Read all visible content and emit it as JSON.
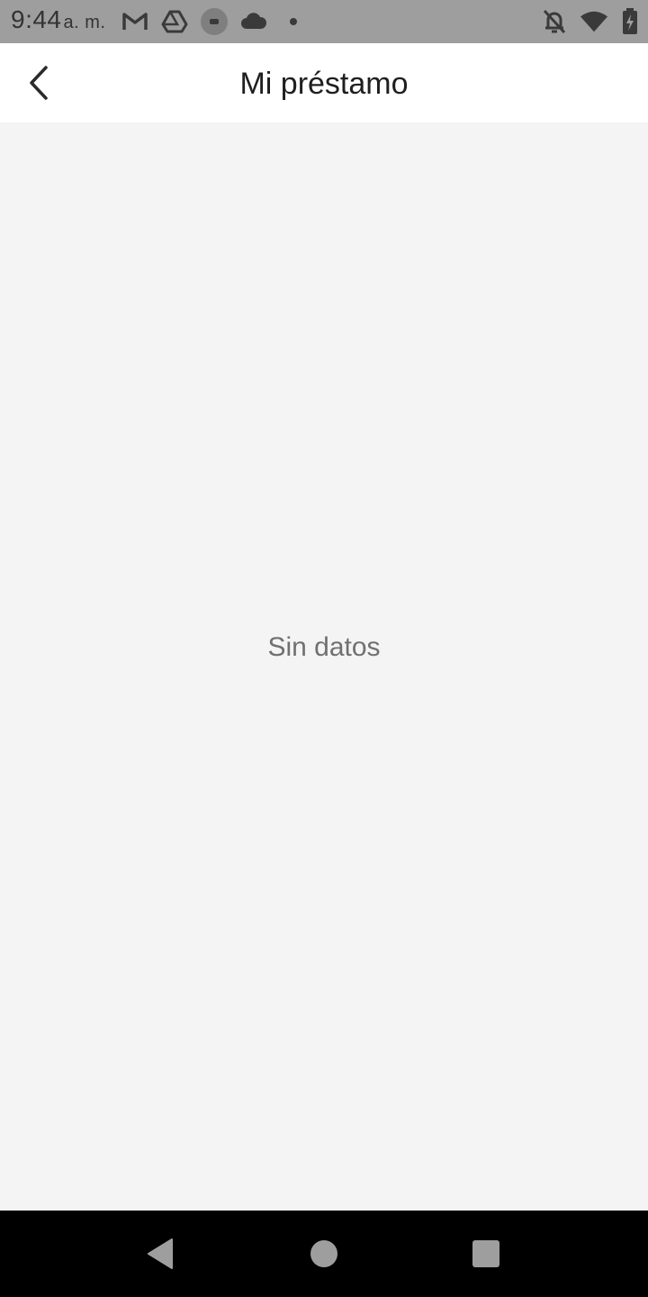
{
  "status_bar": {
    "time": "9:44",
    "ampm": "a. m.",
    "left_icons": [
      "gmail-icon",
      "drive-icon",
      "record-icon",
      "cloud-icon",
      "dot-icon"
    ],
    "right_icons": [
      "bell-off-icon",
      "wifi-icon",
      "battery-charging-icon"
    ]
  },
  "app_bar": {
    "title": "Mi préstamo",
    "back_icon": "chevron-left-icon"
  },
  "content": {
    "empty_message": "Sin datos"
  },
  "nav_bar": {
    "buttons": [
      "back-triangle-icon",
      "home-circle-icon",
      "recents-square-icon"
    ]
  },
  "colors": {
    "status_bar_bg": "#9e9e9e",
    "app_bar_bg": "#ffffff",
    "content_bg": "#f4f4f4",
    "nav_bar_bg": "#000000",
    "empty_text": "#707070"
  }
}
